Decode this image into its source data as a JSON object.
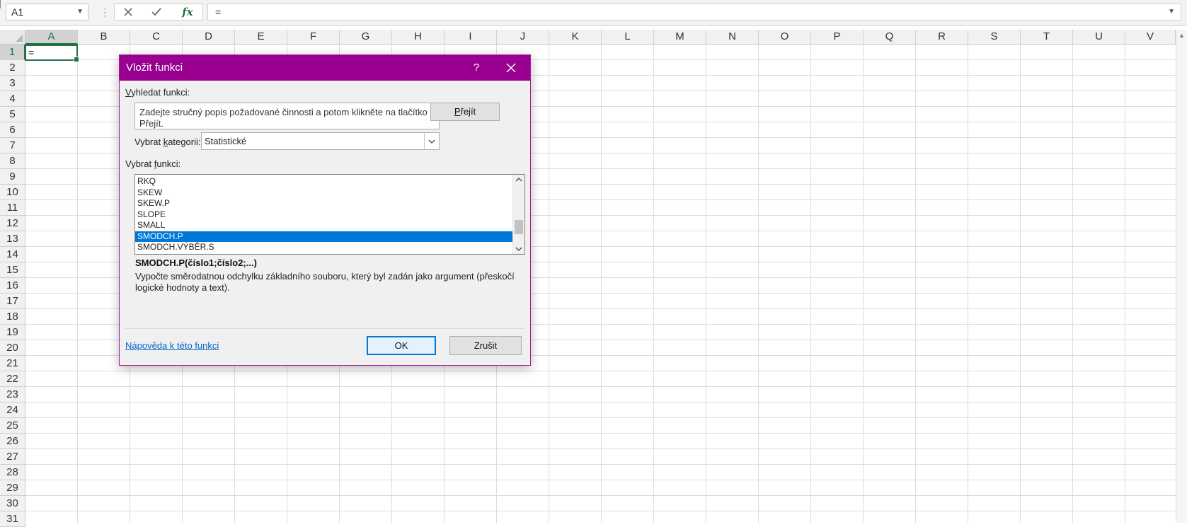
{
  "formula_bar": {
    "name_box": "A1",
    "formula": "=",
    "fx_label": "fx"
  },
  "grid": {
    "columns": [
      "A",
      "B",
      "C",
      "D",
      "E",
      "F",
      "G",
      "H",
      "I",
      "J",
      "K",
      "L",
      "M",
      "N",
      "O",
      "P",
      "Q",
      "R",
      "S",
      "T",
      "U",
      "V"
    ],
    "rows": [
      "1",
      "2",
      "3",
      "4",
      "5",
      "6",
      "7",
      "8",
      "9",
      "10",
      "11",
      "12",
      "13",
      "14",
      "15",
      "16",
      "17",
      "18",
      "19",
      "20",
      "21",
      "22",
      "23",
      "24",
      "25",
      "26",
      "27",
      "28",
      "29",
      "30",
      "31"
    ],
    "active_cell_value": "="
  },
  "dialog": {
    "title": "Vložit funkci",
    "help_label": "?",
    "search_label_accel": "V",
    "search_label_rest": "yhledat funkci:",
    "search_text": "Zadejte stručný popis požadované činnosti a potom klikněte na tlačítko Přejít.",
    "go_button_accel": "P",
    "go_button_rest": "řejít",
    "category_label_pre": "Vybrat ",
    "category_label_accel": "k",
    "category_label_post": "ategorii:",
    "category_value": "Statistické",
    "function_label_pre": "Vybrat ",
    "function_label_accel": "f",
    "function_label_post": "unkci:",
    "functions": [
      "RKQ",
      "SKEW",
      "SKEW.P",
      "SLOPE",
      "SMALL",
      "SMODCH.P",
      "SMODCH.VÝBĚR.S"
    ],
    "selected_function": "SMODCH.P",
    "signature": "SMODCH.P(číslo1;číslo2;...)",
    "description": "Vypočte směrodatnou odchylku základního souboru, který byl zadán jako argument (přeskočí logické hodnoty a text).",
    "help_link": "Nápověda k této funkci",
    "ok_label": "OK",
    "cancel_label": "Zrušit"
  },
  "colors": {
    "dialog_title_bg": "#99008f",
    "excel_green": "#217346",
    "selection_blue": "#0078d7"
  }
}
